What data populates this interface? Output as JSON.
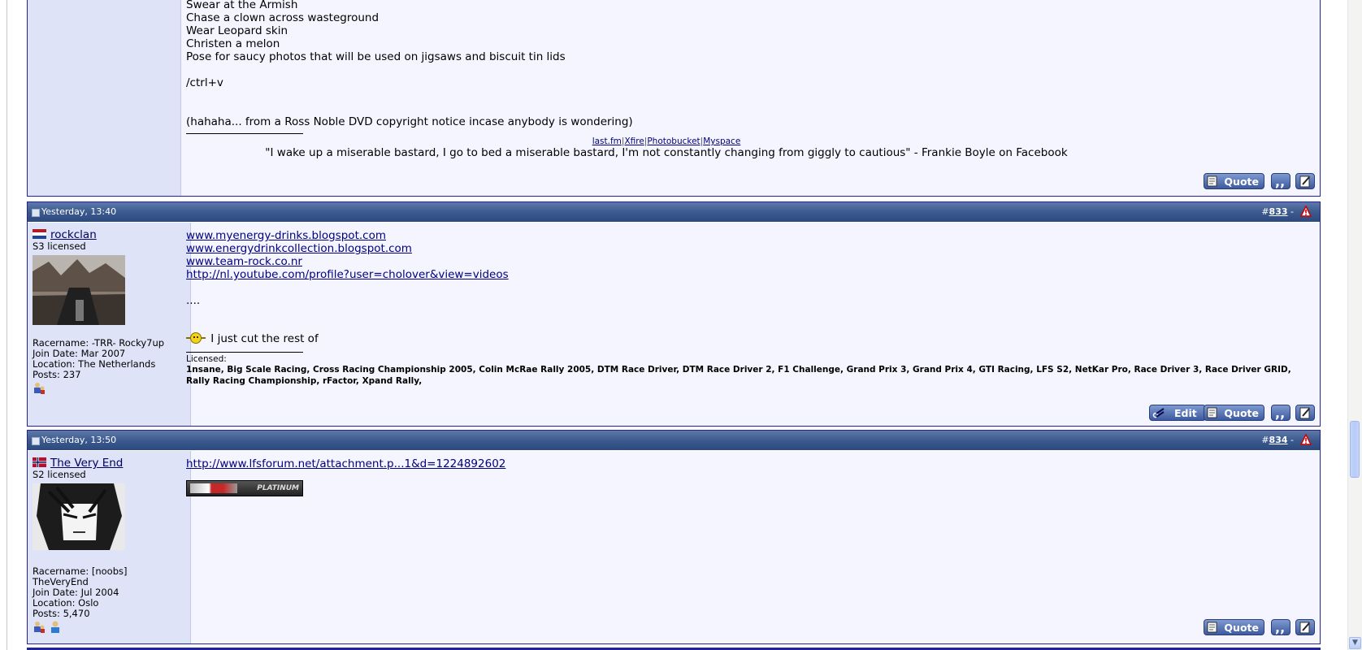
{
  "post832": {
    "lines": [
      "Swear at the Armish",
      "Chase a clown across wasteground",
      "Wear Leopard skin",
      "Christen a melon",
      "Pose for saucy photos that will be used on jigsaws and biscuit tin lids"
    ],
    "ctrlv": "/ctrl+v",
    "note": "(hahaha... from a Ross Noble DVD copyright notice incase anybody is wondering)",
    "sig_links": [
      "last.fm",
      "Xfire",
      "Photobucket",
      "Myspace"
    ],
    "sig_sep": "|",
    "sig_quote": "\"I wake up a miserable bastard, I go to bed a miserable bastard, I'm not constantly changing from giggly to cautious\" - Frankie Boyle on Facebook",
    "quote_label": "Quote"
  },
  "post833": {
    "date": "Yesterday, 13:40",
    "hash": "#",
    "number": "833",
    "dash": "-",
    "username": "rockclan",
    "license": "S3 licensed",
    "racername": "Racername: -TRR- Rocky7up",
    "join_date": "Join Date: Mar 2007",
    "location": "Location: The Netherlands",
    "posts": "Posts: 237",
    "links": [
      "www.myenergy-drinks.blogspot.com",
      "www.energydrinkcollection.blogspot.com",
      "www.team-rock.co.nr",
      "http://nl.youtube.com/profile?user=cholover&view=videos"
    ],
    "dots": "....",
    "cut_text": "I just cut the rest of",
    "licensed_label": "Licensed:",
    "licensed_games": "1nsane, Big Scale Racing, Cross Racing Championship 2005, Colin McRae Rally 2005, DTM Race Driver, DTM Race Driver 2, F1 Challenge, Grand Prix 3, Grand Prix 4, GTI Racing, LFS S2, NetKar Pro, Race Driver 3, Race Driver GRID, Rally Racing Championship, rFactor, Xpand Rally,",
    "edit_label": "Edit",
    "quote_label": "Quote"
  },
  "post834": {
    "date": "Yesterday, 13:50",
    "hash": "#",
    "number": "834",
    "dash": "-",
    "username": "The Very End",
    "license": "S2 licensed",
    "racername": "Racername: [noobs] TheVeryEnd",
    "join_date": "Join Date: Jul 2004",
    "location": "Location: Oslo",
    "posts": "Posts: 5,470",
    "link": "http://www.lfsforum.net/attachment.p...1&d=1224892602",
    "banner_text": "PLATINUM",
    "quote_label": "Quote"
  }
}
